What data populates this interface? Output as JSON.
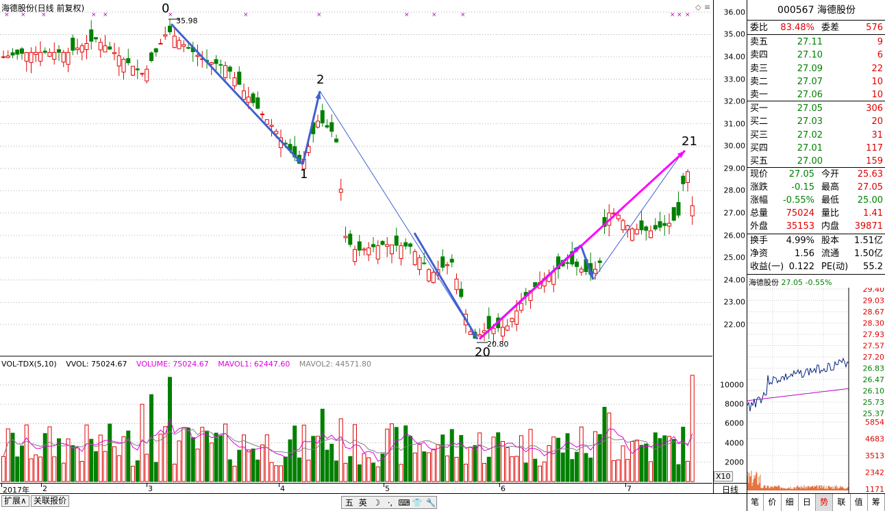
{
  "chart_title": "海德股份(日线 前复权)",
  "price_axis": {
    "ylim": [
      20.8,
      36.3
    ],
    "ticks": [
      "36.00",
      "35.00",
      "34.00",
      "33.00",
      "32.00",
      "31.00",
      "30.00",
      "29.00",
      "28.00",
      "27.00",
      "26.00",
      "25.00",
      "24.00",
      "23.00",
      "22.00"
    ]
  },
  "annotations": {
    "high_label": "35.98",
    "low_label": "20.80",
    "wave_labels": [
      "0",
      "1",
      "2",
      "20",
      "21"
    ]
  },
  "volume_indicator": {
    "name": "VOL-TDX(5,10)",
    "vvol": "VVOL: 75024.67",
    "volume": "VOLUME: 75024.67",
    "mavol1": "MAVOL1: 62447.60",
    "mavol2": "MAVOL2: 44571.80",
    "ticks": [
      "10000",
      "8000",
      "6000",
      "4000",
      "2000"
    ],
    "x10": "X10"
  },
  "x_axis": {
    "labels": [
      "2017年",
      "2",
      "3",
      "4",
      "5",
      "6",
      "7"
    ]
  },
  "bottom_tabs": {
    "expand": "扩展∧",
    "related": "关联报价"
  },
  "toolbar_icons": [
    "五",
    "英",
    "☽",
    "·,",
    "⌨",
    "👕",
    "🔧"
  ],
  "period_label": "日线",
  "colors": {
    "up": "#e00000",
    "down": "#008000",
    "ma_pink": "#e000e0",
    "ma_gray": "#808080",
    "wave_blue": "#4060d0",
    "wave_magenta": "#ff00ff"
  },
  "quote": {
    "code": "000567",
    "name": "海德股份",
    "weibi_label": "委比",
    "weibi": "83.48%",
    "weicha_label": "委差",
    "weicha": "576",
    "asks": [
      {
        "label": "卖五",
        "price": "27.11",
        "vol": "9"
      },
      {
        "label": "卖四",
        "price": "27.10",
        "vol": "6"
      },
      {
        "label": "卖三",
        "price": "27.09",
        "vol": "22"
      },
      {
        "label": "卖二",
        "price": "27.07",
        "vol": "10"
      },
      {
        "label": "卖一",
        "price": "27.06",
        "vol": "10"
      }
    ],
    "bids": [
      {
        "label": "买一",
        "price": "27.05",
        "vol": "306"
      },
      {
        "label": "买二",
        "price": "27.03",
        "vol": "20"
      },
      {
        "label": "买三",
        "price": "27.02",
        "vol": "31"
      },
      {
        "label": "买四",
        "price": "27.01",
        "vol": "117"
      },
      {
        "label": "买五",
        "price": "27.00",
        "vol": "159"
      }
    ],
    "stats": [
      {
        "l1": "现价",
        "v1": "27.05",
        "l2": "今开",
        "v2": "25.63"
      },
      {
        "l1": "涨跌",
        "v1": "-0.15",
        "l2": "最高",
        "v2": "27.05"
      },
      {
        "l1": "涨幅",
        "v1": "-0.55%",
        "l2": "最低",
        "v2": "25.00"
      },
      {
        "l1": "总量",
        "v1": "75024",
        "l2": "量比",
        "v2": "1.41"
      },
      {
        "l1": "外盘",
        "v1": "35153",
        "l2": "内盘",
        "v2": "39871"
      }
    ],
    "fund": [
      {
        "l1": "换手",
        "v1": "4.99%",
        "l2": "股本",
        "v2": "1.51亿"
      },
      {
        "l1": "净资",
        "v1": "1.56",
        "l2": "流通",
        "v2": "1.50亿"
      },
      {
        "l1": "收益(一)",
        "v1": "0.122",
        "l2": "PE(动)",
        "v2": "55.2"
      }
    ]
  },
  "mini_chart": {
    "name": "海德股份",
    "price": "27.05",
    "pct": "-0.55%",
    "price_ticks": [
      "29.40",
      "29.03",
      "28.67",
      "28.30",
      "27.93",
      "27.57",
      "27.20",
      "26.83",
      "26.47",
      "26.10",
      "25.73",
      "25.37"
    ],
    "vol_ticks": [
      "5854",
      "4683",
      "3513",
      "2342",
      "1171"
    ]
  },
  "right_tabs": [
    "笔",
    "价",
    "细",
    "日",
    "势",
    "联",
    "值",
    "筹"
  ],
  "active_right_tab": "势"
}
